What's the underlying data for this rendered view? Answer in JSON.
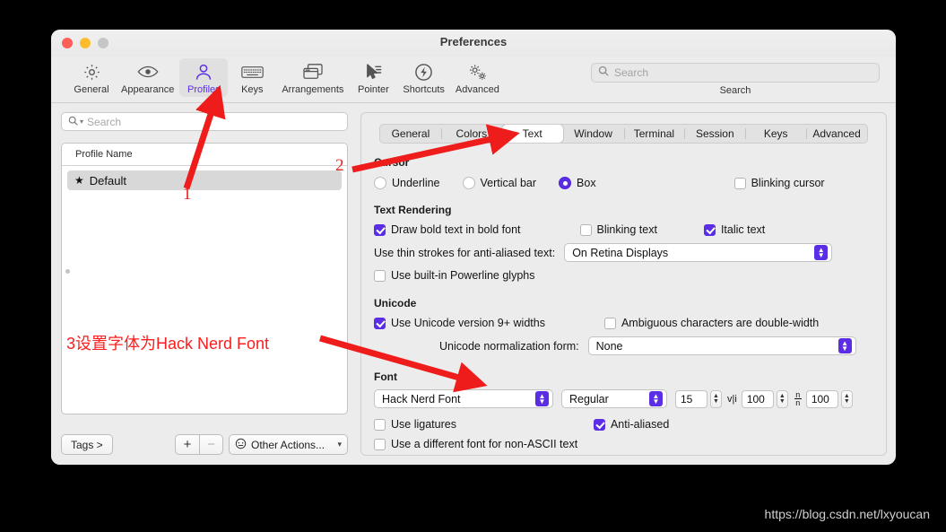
{
  "window": {
    "title": "Preferences",
    "traffic_lights": [
      "close",
      "minimize",
      "zoom"
    ]
  },
  "toolbar": {
    "items": [
      {
        "label": "General",
        "icon": "gear-icon",
        "active": false
      },
      {
        "label": "Appearance",
        "icon": "eye-icon",
        "active": false
      },
      {
        "label": "Profiles",
        "icon": "person-icon",
        "active": true
      },
      {
        "label": "Keys",
        "icon": "keyboard-icon",
        "active": false
      },
      {
        "label": "Arrangements",
        "icon": "windows-icon",
        "active": false
      },
      {
        "label": "Pointer",
        "icon": "cursor-icon",
        "active": false
      },
      {
        "label": "Shortcuts",
        "icon": "bolt-circle-icon",
        "active": false
      },
      {
        "label": "Advanced",
        "icon": "gears-icon",
        "active": false
      }
    ],
    "search_placeholder": "Search",
    "search_value": "",
    "search_caption": "Search"
  },
  "sidebar": {
    "search_placeholder": "Search",
    "search_value": "",
    "list_header": "Profile Name",
    "profiles": [
      {
        "name": "Default",
        "starred": true,
        "selected": true
      }
    ],
    "tags_button": "Tags >",
    "add_button": "+",
    "remove_button": "−",
    "other_actions": "Other Actions...",
    "other_actions_chevron": "⌄"
  },
  "panel": {
    "tabs": [
      {
        "label": "General",
        "active": false
      },
      {
        "label": "Colors",
        "active": false
      },
      {
        "label": "Text",
        "active": true
      },
      {
        "label": "Window",
        "active": false
      },
      {
        "label": "Terminal",
        "active": false
      },
      {
        "label": "Session",
        "active": false
      },
      {
        "label": "Keys",
        "active": false
      },
      {
        "label": "Advanced",
        "active": false
      }
    ],
    "cursor": {
      "title": "Cursor",
      "options": [
        {
          "label": "Underline",
          "selected": false
        },
        {
          "label": "Vertical bar",
          "selected": false
        },
        {
          "label": "Box",
          "selected": true
        }
      ],
      "blinking_cursor": {
        "label": "Blinking cursor",
        "checked": false
      }
    },
    "text_rendering": {
      "title": "Text Rendering",
      "draw_bold": {
        "label": "Draw bold text in bold font",
        "checked": true
      },
      "blinking_text": {
        "label": "Blinking text",
        "checked": false
      },
      "italic_text": {
        "label": "Italic text",
        "checked": true
      },
      "thin_strokes_label": "Use thin strokes for anti-aliased text:",
      "thin_strokes_value": "On Retina Displays",
      "powerline": {
        "label": "Use built-in Powerline glyphs",
        "checked": false
      }
    },
    "unicode": {
      "title": "Unicode",
      "v9_widths": {
        "label": "Use Unicode version 9+ widths",
        "checked": true
      },
      "ambiguous": {
        "label": "Ambiguous characters are double-width",
        "checked": false
      },
      "normalization_label": "Unicode normalization form:",
      "normalization_value": "None"
    },
    "font": {
      "title": "Font",
      "family_value": "Hack Nerd Font",
      "style_value": "Regular",
      "size_value": "15",
      "horizontal_icon": "v|i",
      "horizontal_value": "100",
      "vertical_icon_top": "n",
      "vertical_icon_bottom": "n",
      "vertical_value": "100",
      "ligatures": {
        "label": "Use ligatures",
        "checked": false
      },
      "antialiased": {
        "label": "Anti-aliased",
        "checked": true
      },
      "non_ascii": {
        "label": "Use a different font for non-ASCII text",
        "checked": false
      }
    }
  },
  "annotations": {
    "color": "#ef1c1c",
    "marks": [
      {
        "id": "1",
        "text": "1"
      },
      {
        "id": "2",
        "text": "2"
      },
      {
        "id": "3",
        "text": "3设置字体为Hack Nerd Font"
      }
    ]
  },
  "watermark": "https://blog.csdn.net/lxyoucan"
}
